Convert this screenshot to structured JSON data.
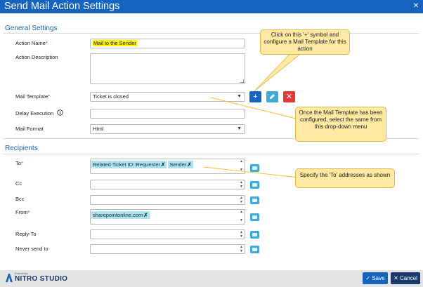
{
  "window": {
    "title": "Send Mail Action Settings",
    "close_glyph": "✕"
  },
  "general": {
    "section_title": "General Settings",
    "action_name": {
      "label": "Action Name",
      "required": "*",
      "value": "Mail to the Sender"
    },
    "action_description": {
      "label": "Action Description",
      "value": ""
    },
    "mail_template": {
      "label": "Mail Template",
      "required": "*",
      "value": "Ticket is closed",
      "add_label": "+",
      "edit_icon": "pencil-icon",
      "delete_label": "✕"
    },
    "delay_execution": {
      "label": "Delay Execution",
      "info_icon": "info-icon",
      "value": ""
    },
    "mail_format": {
      "label": "Mail Format",
      "value": "Html"
    }
  },
  "recipients": {
    "section_title": "Recipients",
    "to": {
      "label": "To",
      "required": "*",
      "tags": [
        "Related Ticket ID::Requester",
        "Sender"
      ]
    },
    "cc": {
      "label": "Cc",
      "tags": []
    },
    "bcc": {
      "label": "Bcc",
      "tags": []
    },
    "from": {
      "label": "From",
      "required": "*",
      "tags": [
        "sharepointonline.com"
      ]
    },
    "reply_to": {
      "label": "Reply-To",
      "tags": []
    },
    "never_send_to": {
      "label": "Never send to",
      "tags": []
    }
  },
  "callouts": {
    "add_template": "Click on this '+' symbol and configure a Mail Template for this action",
    "select_template": "Once the Mail Template has been configured, select the same from this drop-down menu",
    "to_addresses": "Specify the 'To' addresses as shown"
  },
  "footer": {
    "powered_by": "Powered by",
    "brand": "NITRO STUDIO",
    "save_label": "Save",
    "cancel_label": "Cancel",
    "save_glyph": "✓",
    "cancel_glyph": "✕"
  },
  "colors": {
    "primary": "#1565c0",
    "accent": "#3fa9d8",
    "danger": "#e53935",
    "callout": "#ffe9a3",
    "arrow": "#c0392b"
  }
}
